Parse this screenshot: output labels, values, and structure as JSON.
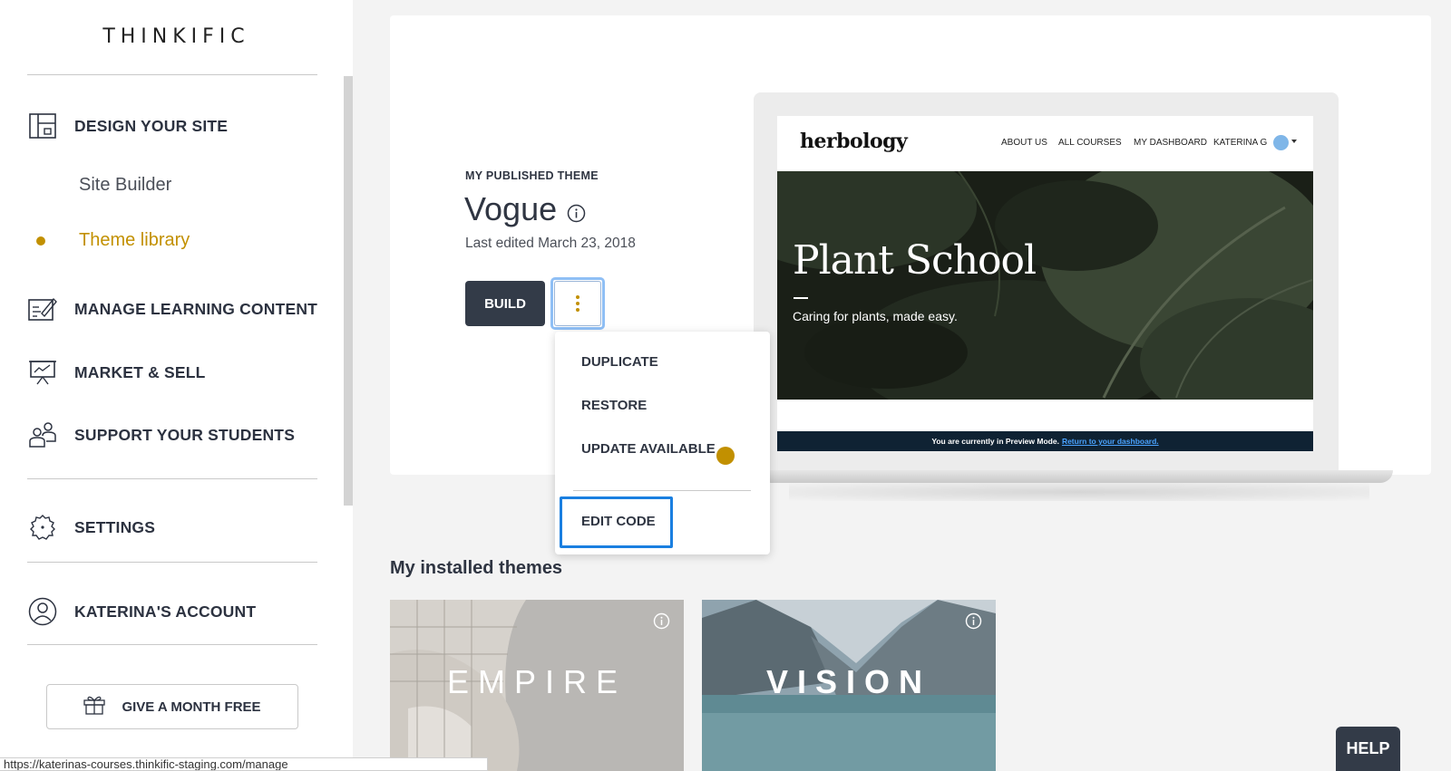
{
  "sidebar": {
    "logo": "THINKIFIC",
    "items": [
      {
        "label": "DESIGN YOUR SITE"
      },
      {
        "label": "MANAGE LEARNING CONTENT"
      },
      {
        "label": "MARKET & SELL"
      },
      {
        "label": "SUPPORT YOUR STUDENTS"
      },
      {
        "label": "SETTINGS"
      },
      {
        "label": "KATERINA'S ACCOUNT"
      }
    ],
    "sub_items": [
      {
        "label": "Site Builder",
        "active": false
      },
      {
        "label": "Theme library",
        "active": true
      }
    ],
    "gift_button": "GIVE A MONTH FREE"
  },
  "main": {
    "published_caption": "MY PUBLISHED THEME",
    "theme_name": "Vogue",
    "last_edited": "Last edited March 23, 2018",
    "build_button": "BUILD",
    "menu": {
      "items": [
        "DUPLICATE",
        "RESTORE",
        "UPDATE AVAILABLE",
        "EDIT CODE"
      ],
      "update_badge_color": "#c29000",
      "focused_item": "EDIT CODE"
    },
    "preview": {
      "brand": "herbology",
      "nav": [
        "ABOUT US",
        "ALL COURSES",
        "MY DASHBOARD",
        "KATERINA G"
      ],
      "hero_title": "Plant School",
      "hero_subtitle": "Caring for plants, made easy.",
      "preview_notice": "You are currently in Preview Mode.",
      "preview_link": "Return to your dashboard."
    },
    "installed_title": "My installed themes",
    "installed_themes": [
      {
        "name": "EMPIRE"
      },
      {
        "name": "VISION"
      }
    ]
  },
  "help_button": "HELP",
  "status_url": "https://katerinas-courses.thinkific-staging.com/manage",
  "colors": {
    "accent": "#c29000",
    "dark_button": "#333b48",
    "focus_blue": "#1a7fe0"
  }
}
